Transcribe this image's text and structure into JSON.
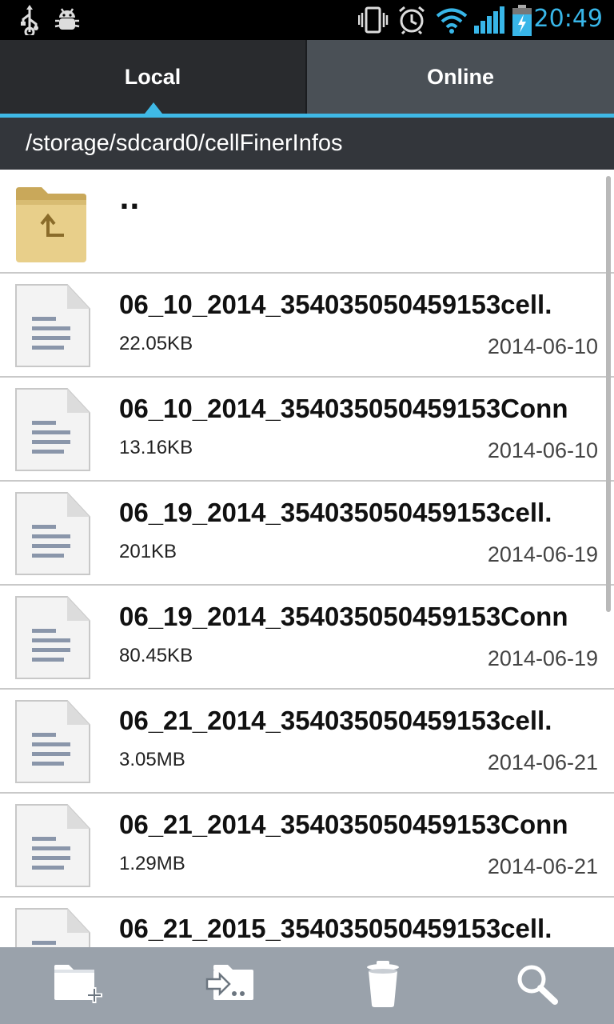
{
  "status_bar": {
    "time": "20:49",
    "icons": [
      "usb-icon",
      "debug-icon",
      "vibrate-icon",
      "alarm-icon",
      "wifi-icon",
      "signal-icon",
      "battery-charging-icon"
    ]
  },
  "tabs": [
    {
      "label": "Local",
      "selected": true
    },
    {
      "label": "Online",
      "selected": false
    }
  ],
  "path": "/storage/sdcard0/cellFinerInfos",
  "parent_label": "..",
  "files": [
    {
      "name": "06_10_2014_354035050459153cell.",
      "size": "22.05KB",
      "date": "2014-06-10"
    },
    {
      "name": "06_10_2014_354035050459153Conn",
      "size": "13.16KB",
      "date": "2014-06-10"
    },
    {
      "name": "06_19_2014_354035050459153cell.",
      "size": "201KB",
      "date": "2014-06-19"
    },
    {
      "name": "06_19_2014_354035050459153Conn",
      "size": "80.45KB",
      "date": "2014-06-19"
    },
    {
      "name": "06_21_2014_354035050459153cell.",
      "size": "3.05MB",
      "date": "2014-06-21"
    },
    {
      "name": "06_21_2014_354035050459153Conn",
      "size": "1.29MB",
      "date": "2014-06-21"
    },
    {
      "name": "06_21_2015_354035050459153cell.",
      "size": "",
      "date": ""
    }
  ],
  "toolbar": {
    "actions": [
      "new-folder-icon",
      "move-icon",
      "delete-icon",
      "search-icon"
    ]
  },
  "colors": {
    "accent": "#3fb9e6",
    "tab_selected": "#292b2e",
    "tab_unselected": "#4a5056",
    "path_bar": "#33363b",
    "bottom_bar": "#9aa2ab"
  }
}
